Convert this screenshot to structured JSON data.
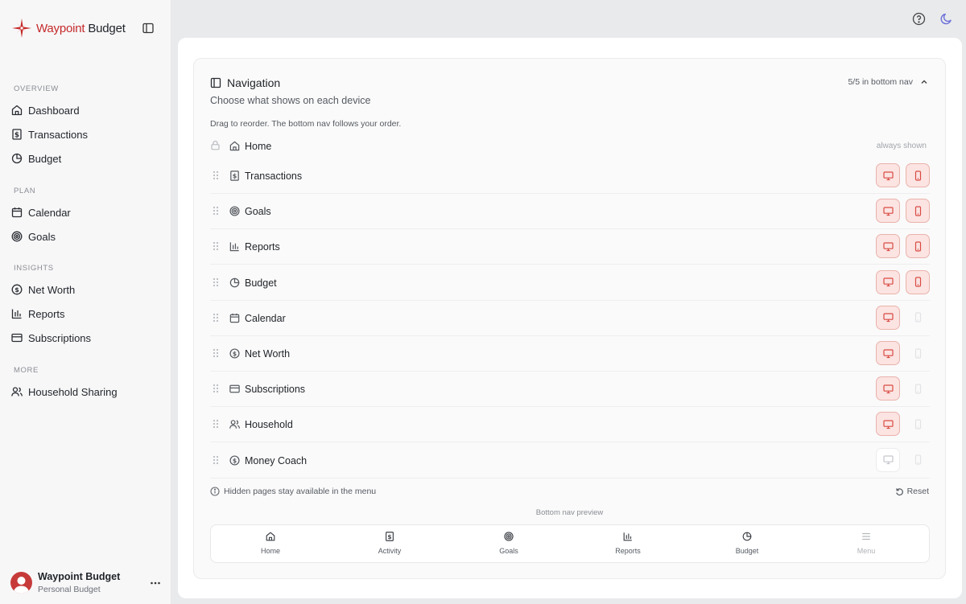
{
  "brand": {
    "name_part1": "Waypoint",
    "name_part2": "Budget",
    "accent": "#c62a2a"
  },
  "sidebar": {
    "toggle_icon": "sidebar-panel-icon",
    "sections": [
      {
        "label": "OVERVIEW",
        "items": [
          {
            "label": "Dashboard",
            "icon": "home-icon"
          },
          {
            "label": "Transactions",
            "icon": "receipt-dollar-icon"
          },
          {
            "label": "Budget",
            "icon": "pie-chart-icon"
          }
        ]
      },
      {
        "label": "PLAN",
        "items": [
          {
            "label": "Calendar",
            "icon": "calendar-icon"
          },
          {
            "label": "Goals",
            "icon": "target-icon"
          }
        ]
      },
      {
        "label": "INSIGHTS",
        "items": [
          {
            "label": "Net Worth",
            "icon": "dollar-circle-icon"
          },
          {
            "label": "Reports",
            "icon": "bar-chart-icon"
          },
          {
            "label": "Subscriptions",
            "icon": "credit-card-icon"
          }
        ]
      },
      {
        "label": "MORE",
        "items": [
          {
            "label": "Household Sharing",
            "icon": "users-icon"
          }
        ]
      }
    ]
  },
  "account": {
    "name": "Waypoint Budget",
    "subtitle": "Personal Budget",
    "avatar_color": "#c73a3a"
  },
  "topbar": {
    "help_icon": "help-circle-icon",
    "theme_icon": "moon-icon"
  },
  "navigation_card": {
    "title": "Navigation",
    "subtitle": "Choose what shows on each device",
    "count_label": "5/5 in bottom nav",
    "hint": "Drag to reorder. The bottom nav follows your order.",
    "home": {
      "label": "Home",
      "status": "always shown"
    },
    "items": [
      {
        "label": "Transactions",
        "icon": "receipt-dollar-icon",
        "desktop": "on",
        "mobile": "on"
      },
      {
        "label": "Goals",
        "icon": "target-icon",
        "desktop": "on",
        "mobile": "on"
      },
      {
        "label": "Reports",
        "icon": "bar-chart-icon",
        "desktop": "on",
        "mobile": "on"
      },
      {
        "label": "Budget",
        "icon": "pie-chart-icon",
        "desktop": "on",
        "mobile": "on"
      },
      {
        "label": "Calendar",
        "icon": "calendar-icon",
        "desktop": "on",
        "mobile": "ghost"
      },
      {
        "label": "Net Worth",
        "icon": "dollar-circle-icon",
        "desktop": "on",
        "mobile": "ghost"
      },
      {
        "label": "Subscriptions",
        "icon": "credit-card-icon",
        "desktop": "on",
        "mobile": "ghost"
      },
      {
        "label": "Household",
        "icon": "users-icon",
        "desktop": "on",
        "mobile": "ghost"
      },
      {
        "label": "Money Coach",
        "icon": "dollar-circle-icon",
        "desktop": "off",
        "mobile": "ghost"
      }
    ],
    "footnote": "Hidden pages stay available in the menu",
    "reset_label": "Reset",
    "preview_label": "Bottom nav preview",
    "preview_items": [
      {
        "label": "Home",
        "icon": "home-icon",
        "dim": false
      },
      {
        "label": "Activity",
        "icon": "receipt-dollar-icon",
        "dim": false
      },
      {
        "label": "Goals",
        "icon": "target-icon",
        "dim": false
      },
      {
        "label": "Reports",
        "icon": "bar-chart-icon",
        "dim": false
      },
      {
        "label": "Budget",
        "icon": "pie-chart-icon",
        "dim": false
      },
      {
        "label": "Menu",
        "icon": "menu-icon",
        "dim": true
      }
    ]
  },
  "colors": {
    "toggle_on_bg": "#fbe4e2",
    "toggle_on_border": "#eab2ac",
    "toggle_on_icon": "#d94a42",
    "app_bg": "#e9eaec",
    "sidebar_bg": "#f7f7f8"
  }
}
